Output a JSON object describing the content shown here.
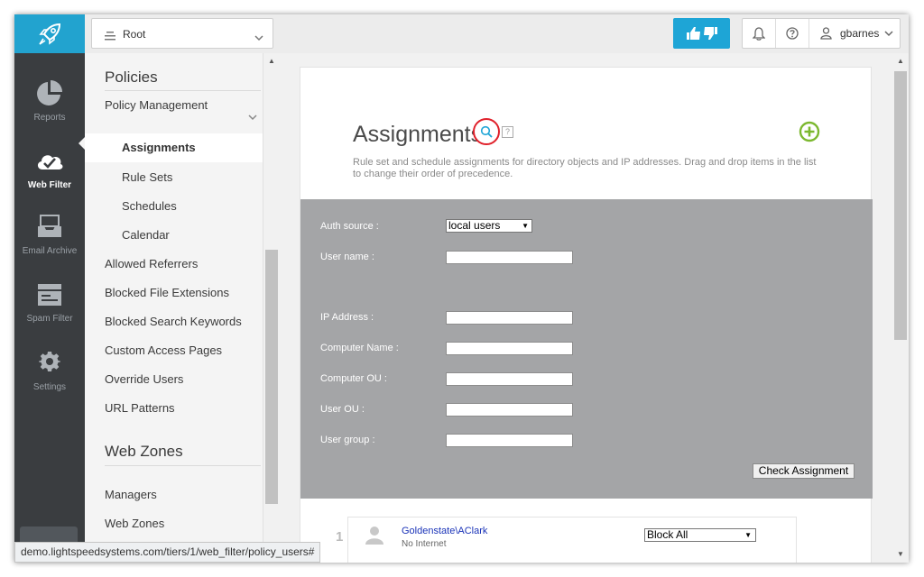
{
  "header": {
    "scope_selector": {
      "value": "Root",
      "icon": "menu-lines-icon"
    },
    "feedback_button_icon": "thumbs-up-down-icon",
    "notifications_icon": "bell-icon",
    "help_icon": "question-circle-icon",
    "user": {
      "name": "gbarnes",
      "icon": "user-icon"
    }
  },
  "sidenav": {
    "items": [
      {
        "label": "Reports",
        "icon": "pie-chart-icon",
        "active": false
      },
      {
        "label": "Web Filter",
        "icon": "cloud-check-icon",
        "active": true
      },
      {
        "label": "Email Archive",
        "icon": "inbox-tray-icon",
        "active": false
      },
      {
        "label": "Spam Filter",
        "icon": "mail-filter-icon",
        "active": false
      },
      {
        "label": "Settings",
        "icon": "gear-icon",
        "active": false
      }
    ]
  },
  "subnav": {
    "section_policies": "Policies",
    "policy_management": "Policy Management",
    "policy_children": [
      "Assignments",
      "Rule Sets",
      "Schedules",
      "Calendar"
    ],
    "policy_links": [
      "Allowed Referrers",
      "Blocked File Extensions",
      "Blocked Search Keywords",
      "Custom Access Pages",
      "Override Users",
      "URL Patterns"
    ],
    "section_web_zones": "Web Zones",
    "web_zone_links": [
      "Managers",
      "Web Zones"
    ]
  },
  "main": {
    "title": "Assignments",
    "help_glyph": "?",
    "description": "Rule set and schedule assignments for directory objects and IP addresses. Drag and drop items in the list to change their order of precedence.",
    "form": {
      "auth_source_label": "Auth source :",
      "auth_source_value": "local users",
      "user_name_label": "User name :",
      "ip_address_label": "IP Address :",
      "computer_name_label": "Computer Name :",
      "computer_ou_label": "Computer OU :",
      "user_ou_label": "User OU :",
      "user_group_label": "User group :",
      "check_button": "Check Assignment"
    },
    "assignments": [
      {
        "index": "1",
        "name": "Goldenstate\\AClark",
        "detail": "No Internet",
        "rule": "Block All"
      }
    ]
  },
  "statusbar": {
    "url": "demo.lightspeedsystems.com/tiers/1/web_filter/policy_users#"
  },
  "colors": {
    "brand": "#22a3cf",
    "sidenav": "#3a3d40",
    "form_panel": "#a4a5a7",
    "add_green": "#7cb82f",
    "highlight_ring": "#e0202a",
    "link": "#1a33b8"
  }
}
